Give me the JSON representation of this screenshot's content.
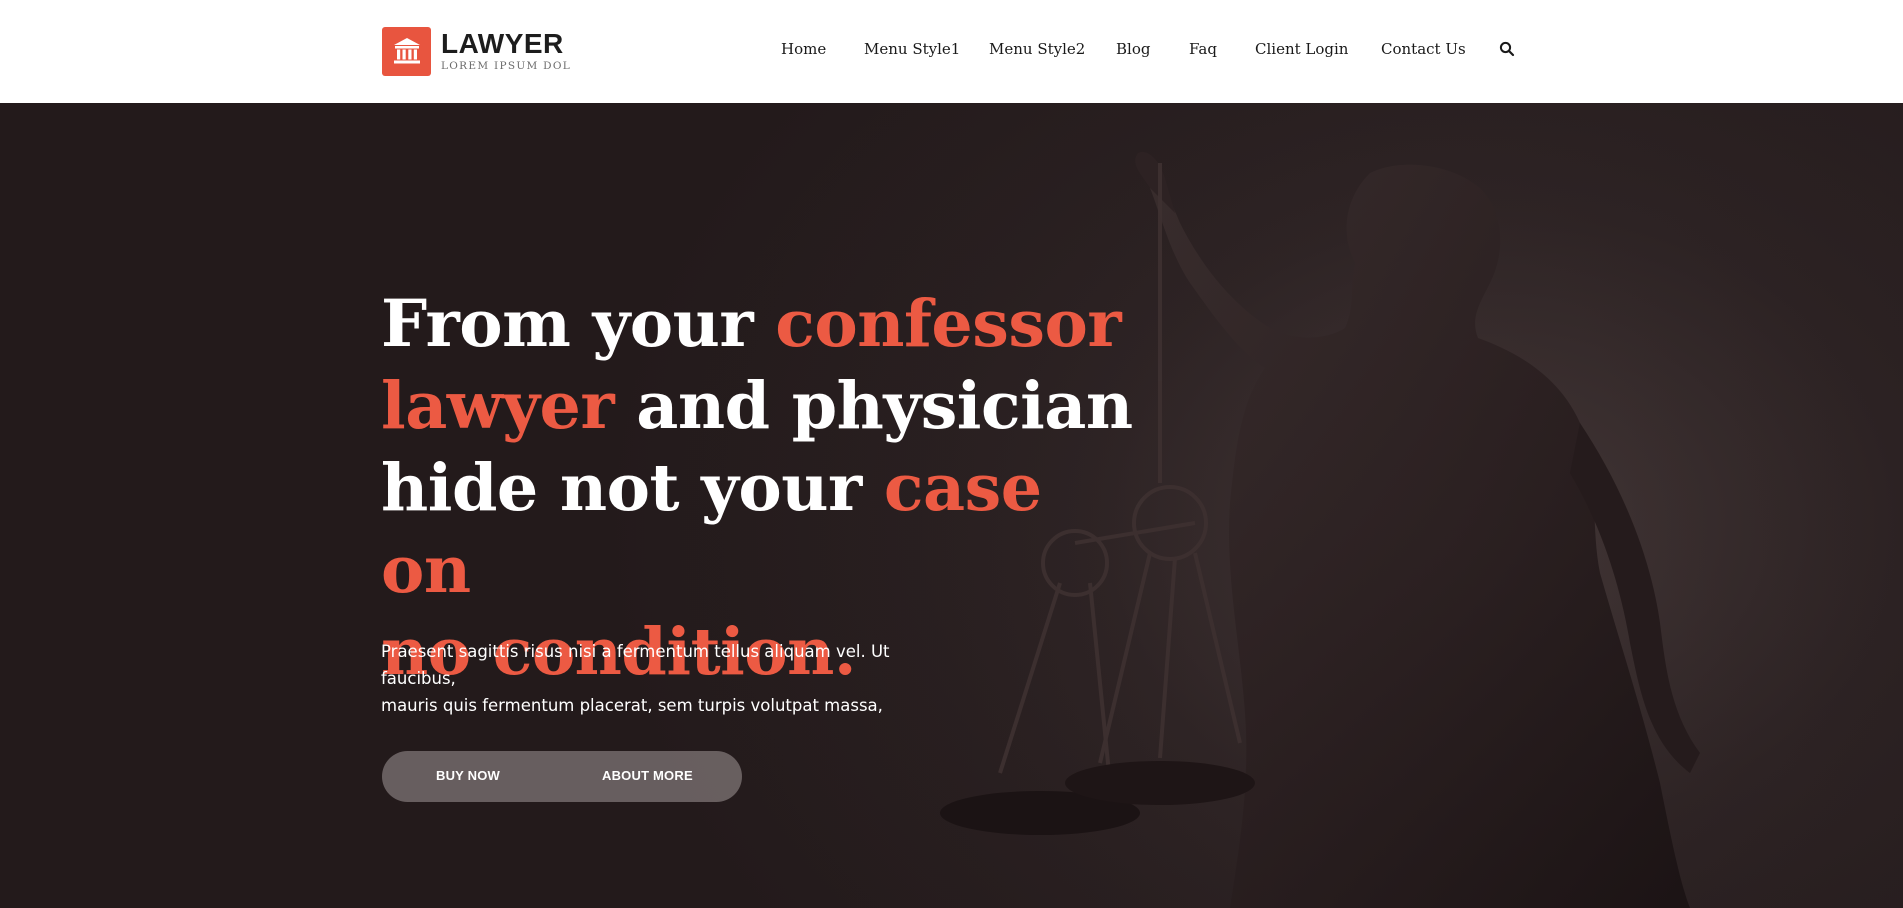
{
  "brand": {
    "title": "LAWYER",
    "tagline": "LOREM IPSUM DOL",
    "logo_icon": "courthouse-icon",
    "accent_color": "#e8553f"
  },
  "nav": {
    "items": [
      {
        "label": "Home"
      },
      {
        "label": "Menu Style1"
      },
      {
        "label": "Menu Style2"
      },
      {
        "label": "Blog"
      },
      {
        "label": "Faq"
      },
      {
        "label": "Client Login"
      },
      {
        "label": "Contact Us"
      }
    ],
    "search_icon": "search-icon"
  },
  "hero": {
    "headline": {
      "part1": "From your ",
      "part2": "confessor",
      "part3": "lawyer",
      "part4": " and physician",
      "part5": "hide not your ",
      "part6": "case on",
      "part7": "no condition."
    },
    "paragraph_line1": "Praesent sagittis risus nisi a fermentum tellus aliquam vel. Ut faucibus,",
    "paragraph_line2": "mauris quis fermentum placerat, sem turpis volutpat massa,",
    "buttons": {
      "buy_now": "BUY NOW",
      "about_more": "ABOUT MORE"
    },
    "background_image": "lady-justice-statue-with-scales",
    "colors": {
      "accent": "#ec5a43",
      "background": "#2a2021",
      "text": "#ffffff"
    }
  }
}
